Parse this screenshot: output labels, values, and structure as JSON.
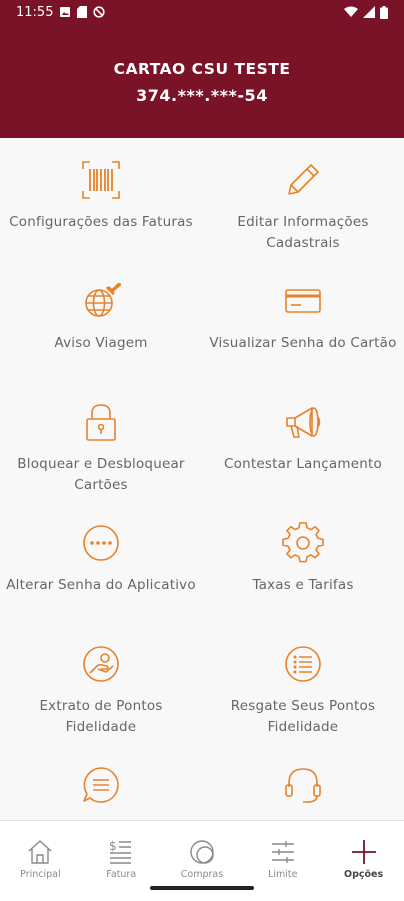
{
  "status_bar": {
    "time": "11:55"
  },
  "header": {
    "card_name": "CARTAO CSU TESTE",
    "card_number": "374.***.***-54"
  },
  "options": [
    {
      "label": "Configurações das Faturas",
      "icon": "barcode-icon"
    },
    {
      "label": "Editar Informações Cadastrais",
      "icon": "pencil-icon"
    },
    {
      "label": "Aviso Viagem",
      "icon": "globe-plane-icon"
    },
    {
      "label": "Visualizar Senha do Cartão",
      "icon": "credit-card-icon"
    },
    {
      "label": "Bloquear e Desbloquear Cartões",
      "icon": "lock-icon"
    },
    {
      "label": "Contestar Lançamento",
      "icon": "megaphone-icon"
    },
    {
      "label": "Alterar Senha do Aplicativo",
      "icon": "password-dots-icon"
    },
    {
      "label": "Taxas e Tarifas",
      "icon": "gear-icon"
    },
    {
      "label": "Extrato de Pontos Fidelidade",
      "icon": "hand-coin-icon"
    },
    {
      "label": "Resgate Seus Pontos Fidelidade",
      "icon": "list-icon"
    },
    {
      "label": "",
      "icon": "chat-icon"
    },
    {
      "label": "",
      "icon": "headset-icon"
    }
  ],
  "bottom_nav": [
    {
      "label": "Principal",
      "icon": "home-icon"
    },
    {
      "label": "Fatura",
      "icon": "invoice-icon"
    },
    {
      "label": "Compras",
      "icon": "purchases-icon"
    },
    {
      "label": "Limite",
      "icon": "sliders-icon"
    },
    {
      "label": "Opções",
      "icon": "plus-icon",
      "active": true
    }
  ],
  "colors": {
    "brand": "#7a1228",
    "accent": "#e8822a",
    "label": "#666666"
  }
}
